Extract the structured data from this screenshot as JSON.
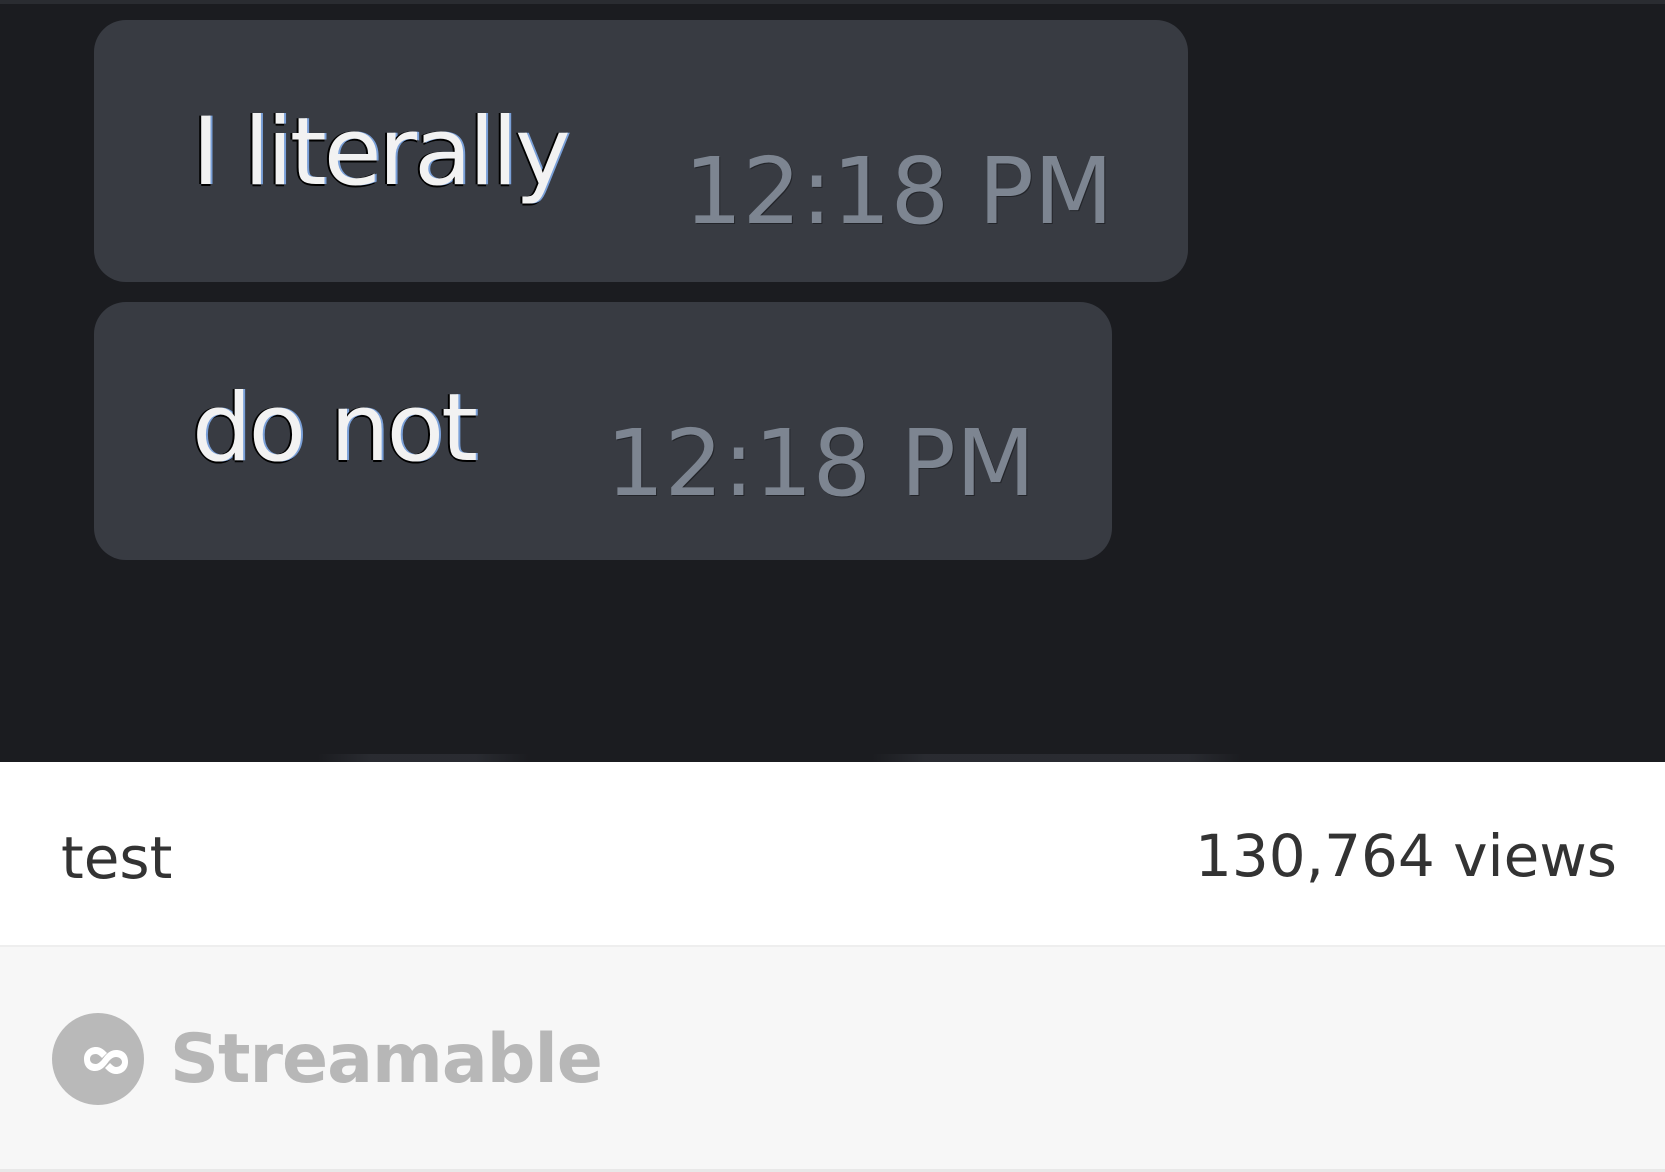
{
  "video": {
    "messages": [
      {
        "text": "I literally",
        "time": "12:18 PM"
      },
      {
        "text": "do not",
        "time": "12:18 PM"
      }
    ]
  },
  "info": {
    "title": "test",
    "views": "130,764 views"
  },
  "brand": {
    "name": "Streamable",
    "icon": "infinity-logo-icon"
  },
  "colors": {
    "video_background": "#1b1c20",
    "bubble": "#383b42",
    "time_text": "#7d8591",
    "brand_gray": "#b7b7b7"
  }
}
